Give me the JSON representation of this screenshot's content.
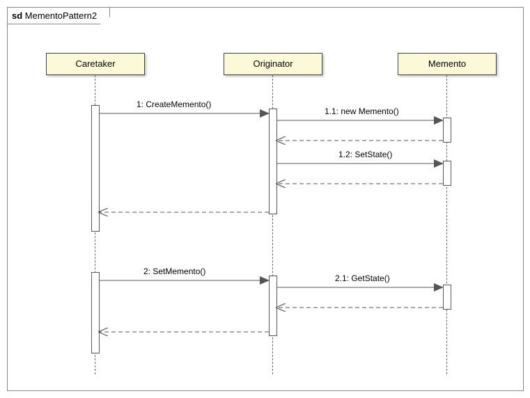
{
  "frame": {
    "prefix": "sd",
    "name": "MementoPattern2"
  },
  "participants": {
    "p1": "Caretaker",
    "p2": "Originator",
    "p3": "Memento"
  },
  "messages": {
    "m1": "1: CreateMemento()",
    "m11": "1.1: new Memento()",
    "m12": "1.2: SetState()",
    "m2": "2: SetMemento()",
    "m21": "2.1: GetState()"
  },
  "chart_data": {
    "type": "sequence-diagram",
    "title": "MementoPattern2",
    "participants": [
      "Caretaker",
      "Originator",
      "Memento"
    ],
    "messages": [
      {
        "from": "Caretaker",
        "to": "Originator",
        "label": "1: CreateMemento()",
        "type": "sync"
      },
      {
        "from": "Originator",
        "to": "Memento",
        "label": "1.1: new Memento()",
        "type": "sync"
      },
      {
        "from": "Memento",
        "to": "Originator",
        "label": "",
        "type": "return"
      },
      {
        "from": "Originator",
        "to": "Memento",
        "label": "1.2: SetState()",
        "type": "sync"
      },
      {
        "from": "Memento",
        "to": "Originator",
        "label": "",
        "type": "return"
      },
      {
        "from": "Originator",
        "to": "Caretaker",
        "label": "",
        "type": "return"
      },
      {
        "from": "Caretaker",
        "to": "Originator",
        "label": "2: SetMemento()",
        "type": "sync"
      },
      {
        "from": "Originator",
        "to": "Memento",
        "label": "2.1: GetState()",
        "type": "sync"
      },
      {
        "from": "Memento",
        "to": "Originator",
        "label": "",
        "type": "return"
      },
      {
        "from": "Originator",
        "to": "Caretaker",
        "label": "",
        "type": "return"
      }
    ]
  }
}
